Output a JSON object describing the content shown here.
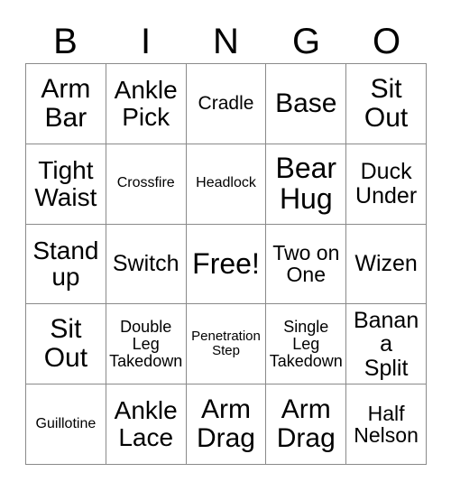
{
  "card": {
    "title": "BINGO",
    "header_letters": [
      "B",
      "I",
      "N",
      "G",
      "O"
    ],
    "rows": 5,
    "columns": 5,
    "free_space": "Free!",
    "colors": {
      "background": "#ffffff",
      "grid_line": "#8a8a8a",
      "text": "#000000"
    },
    "cells": [
      [
        {
          "label": "Arm\nBar",
          "size": "fs-xl"
        },
        {
          "label": "Ankle\nPick",
          "size": "fs-lg"
        },
        {
          "label": "Cradle",
          "size": "fs-xs"
        },
        {
          "label": "Base",
          "size": "fs-xl"
        },
        {
          "label": "Sit\nOut",
          "size": "fs-xl"
        }
      ],
      [
        {
          "label": "Tight\nWaist",
          "size": "fs-lg"
        },
        {
          "label": "Crossfire",
          "size": "fs-tiny"
        },
        {
          "label": "Headlock",
          "size": "fs-tiny"
        },
        {
          "label": "Bear\nHug",
          "size": "fs-xxl"
        },
        {
          "label": "Duck\nUnder",
          "size": "fs-md"
        }
      ],
      [
        {
          "label": "Stand\nup",
          "size": "fs-lg"
        },
        {
          "label": "Switch",
          "size": "fs-md"
        },
        {
          "label": "Free!",
          "size": "fs-xxl"
        },
        {
          "label": "Two on\nOne",
          "size": "fs-sm"
        },
        {
          "label": "Wizen",
          "size": "fs-md"
        }
      ],
      [
        {
          "label": "Sit\nOut",
          "size": "fs-xl"
        },
        {
          "label": "Double\nLeg\nTakedown",
          "size": "fs-xxs"
        },
        {
          "label": "Penetration\nStep",
          "size": "fs-micro"
        },
        {
          "label": "Single\nLeg\nTakedown",
          "size": "fs-xxs"
        },
        {
          "label": "Banana\nSplit",
          "size": "fs-md"
        }
      ],
      [
        {
          "label": "Guillotine",
          "size": "fs-tiny"
        },
        {
          "label": "Ankle\nLace",
          "size": "fs-lg"
        },
        {
          "label": "Arm\nDrag",
          "size": "fs-xl"
        },
        {
          "label": "Arm\nDrag",
          "size": "fs-xl"
        },
        {
          "label": "Half\nNelson",
          "size": "fs-sm"
        }
      ]
    ]
  }
}
